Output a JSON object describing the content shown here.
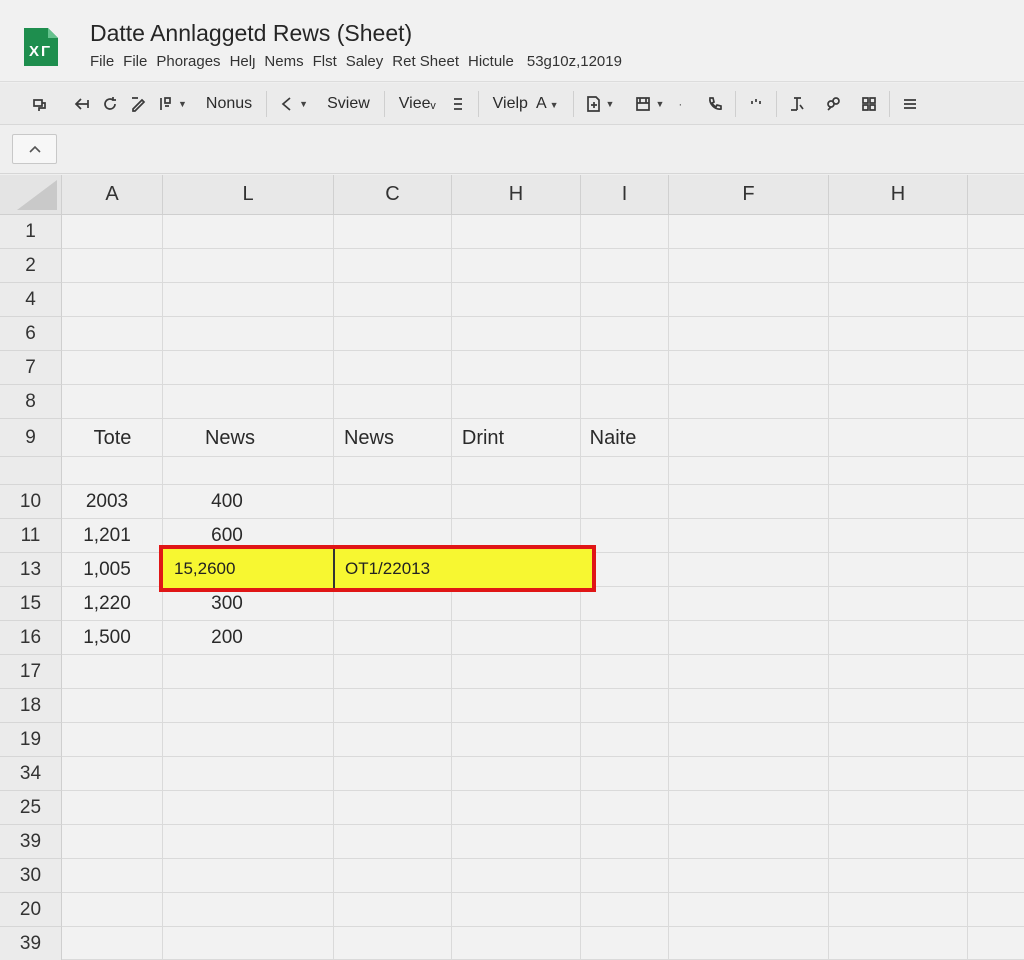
{
  "app": {
    "title": "Datte Annlaggetd Rews (Sheet)",
    "logo_text": "XΓ",
    "accent_color": "#1e8e4e"
  },
  "menu": {
    "items": [
      "File",
      "File",
      "Phorages",
      "Helȷ",
      "Nems",
      "Flst",
      "Saley",
      "Ret Sheet",
      "Hictule"
    ],
    "date": "53g10z,12019"
  },
  "toolbar": {
    "format_label": "Nonus",
    "sview_label": "Sview",
    "view_label": "Vieeᵥ",
    "viep_label": "Vielp",
    "font_label": "A"
  },
  "grid": {
    "columns": [
      "A",
      "L",
      "C",
      "H",
      "I",
      "F",
      "H"
    ],
    "rows": [
      "1",
      "2",
      "4",
      "6",
      "7",
      "8",
      "9",
      "",
      "10",
      "11",
      "13",
      "15",
      "16",
      "17",
      "18",
      "19",
      "34",
      "25",
      "39",
      "30",
      "20",
      "39"
    ],
    "header_row": [
      "Tote",
      "News",
      "News",
      "Drint",
      "Naite"
    ],
    "data": [
      [
        "2003",
        "400"
      ],
      [
        "1,201",
        "600"
      ],
      [
        "1,005",
        "15,2600",
        "OT1/22013"
      ],
      [
        "1,220",
        "300"
      ],
      [
        "1,500",
        "200"
      ]
    ],
    "highlight_color": "#f7f731",
    "highlight_border_color": "#e01616"
  }
}
